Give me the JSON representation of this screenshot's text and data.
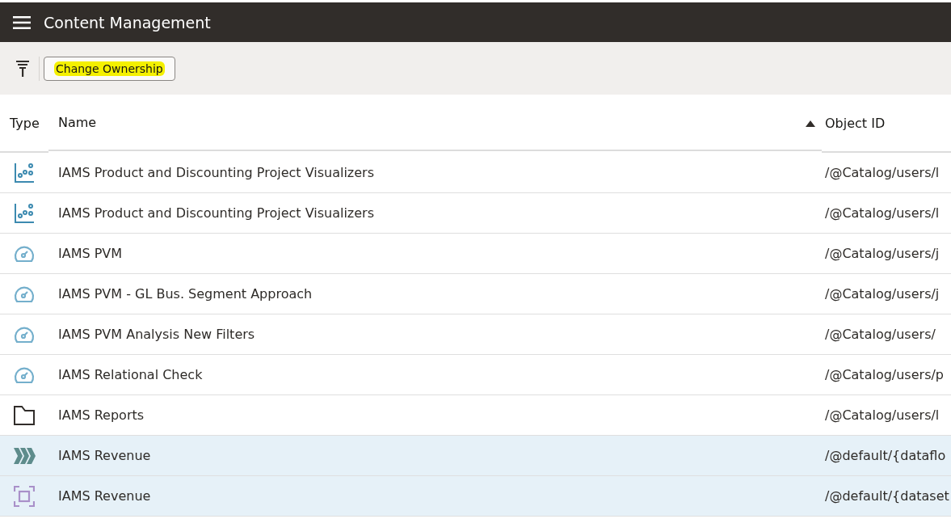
{
  "header": {
    "title": "Content Management"
  },
  "toolbar": {
    "button": {
      "label": "Change Ownership",
      "highlighted": true
    }
  },
  "table": {
    "columns": [
      {
        "label": "Type"
      },
      {
        "label": "Name",
        "sorted_ascending": true
      },
      {
        "label": "Object ID"
      }
    ],
    "rows": [
      {
        "kind": "visualization",
        "name": "IAMS Product and Discounting Project Visualizers",
        "object_id": "/@Catalog/users/l",
        "selected": false
      },
      {
        "kind": "visualization",
        "name": "IAMS Product and Discounting Project Visualizers",
        "object_id": "/@Catalog/users/l",
        "selected": false
      },
      {
        "kind": "dashboard",
        "name": "IAMS PVM",
        "object_id": "/@Catalog/users/j",
        "selected": false
      },
      {
        "kind": "dashboard",
        "name": "IAMS PVM - GL Bus. Segment Approach",
        "object_id": "/@Catalog/users/j",
        "selected": false
      },
      {
        "kind": "dashboard",
        "name": "IAMS PVM Analysis New Filters",
        "object_id": "/@Catalog/users/",
        "selected": false
      },
      {
        "kind": "dashboard",
        "name": "IAMS Relational Check",
        "object_id": "/@Catalog/users/p",
        "selected": false
      },
      {
        "kind": "folder",
        "name": "IAMS Reports",
        "object_id": "/@Catalog/users/l",
        "selected": false
      },
      {
        "kind": "dataflow",
        "name": "IAMS Revenue",
        "object_id": "/@default/{dataflo",
        "selected": true
      },
      {
        "kind": "dataset",
        "name": "IAMS Revenue",
        "object_id": "/@default/{dataset",
        "selected": true
      }
    ]
  }
}
